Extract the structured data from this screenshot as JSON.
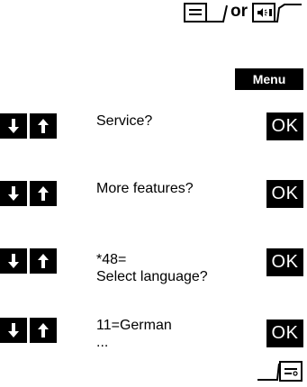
{
  "header": {
    "handset_icon": "lift-handset-icon",
    "or_label": "or",
    "speaker_icon": "speaker-key-icon"
  },
  "menu": {
    "label": "Menu"
  },
  "steps": [
    {
      "line1": "Service?",
      "line2": "",
      "ok_label": "OK"
    },
    {
      "line1": "More features?",
      "line2": "",
      "ok_label": "OK"
    },
    {
      "line1": "*48=",
      "line2": "Select language?",
      "ok_label": "OK"
    },
    {
      "line1": "11=German",
      "line2": "...",
      "ok_label": "OK"
    }
  ],
  "footer": {
    "hangup_icon": "replace-handset-icon"
  }
}
